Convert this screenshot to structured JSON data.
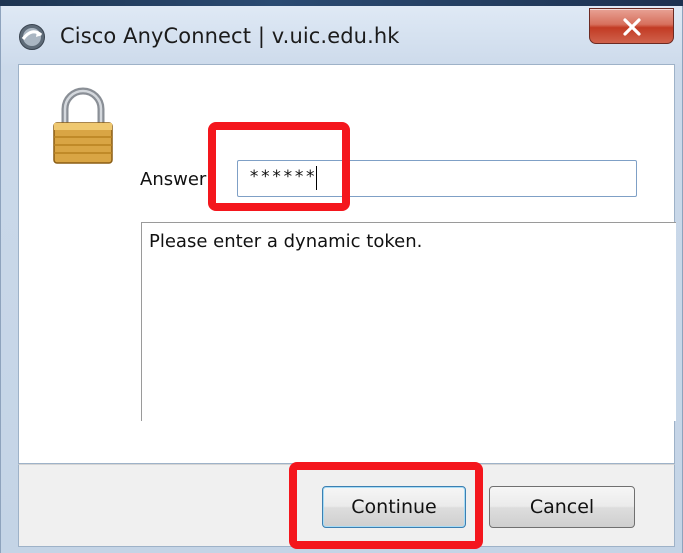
{
  "window": {
    "title": "Cisco AnyConnect | v.uic.edu.hk",
    "close_icon": "close-icon"
  },
  "form": {
    "answer_label": "Answer",
    "answer_value": "******",
    "message": "Please enter a dynamic token."
  },
  "buttons": {
    "continue_label": "Continue",
    "cancel_label": "Cancel"
  },
  "icons": {
    "app": "anyconnect-globe-icon",
    "lock": "padlock-icon"
  },
  "colors": {
    "annotation": "#f4161d",
    "close_button": "#c23b24",
    "input_border": "#7fa0c6"
  }
}
